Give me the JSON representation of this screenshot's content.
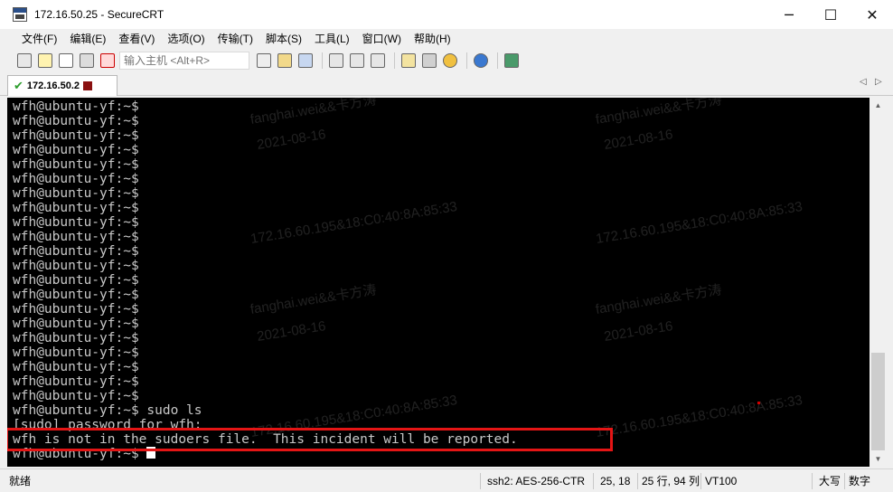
{
  "window": {
    "title": "172.16.50.25 - SecureCRT",
    "minimize": "─",
    "maximize": "☐",
    "close": "✕"
  },
  "menu": [
    "文件(F)",
    "编辑(E)",
    "查看(V)",
    "选项(O)",
    "传输(T)",
    "脚本(S)",
    "工具(L)",
    "窗口(W)",
    "帮助(H)"
  ],
  "toolbar": {
    "host_placeholder": "输入主机 <Alt+R>",
    "icons": [
      "connect-icon",
      "quick-connect-icon",
      "connect-tab-icon",
      "reconnect-icon",
      "disconnect-icon",
      "copy-icon",
      "paste-icon",
      "find-icon",
      "print-icon",
      "print-screen-icon",
      "print-setup-icon",
      "session-options-icon",
      "global-options-icon",
      "keymap-icon",
      "help-icon",
      "sftp-icon"
    ]
  },
  "tab": {
    "label": "172.16.50.2",
    "nav_left": "◁",
    "nav_right": "▷"
  },
  "terminal": {
    "lines": [
      "wfh@ubuntu-yf:~$",
      "wfh@ubuntu-yf:~$",
      "wfh@ubuntu-yf:~$",
      "wfh@ubuntu-yf:~$",
      "wfh@ubuntu-yf:~$",
      "wfh@ubuntu-yf:~$",
      "wfh@ubuntu-yf:~$",
      "wfh@ubuntu-yf:~$",
      "wfh@ubuntu-yf:~$",
      "wfh@ubuntu-yf:~$",
      "wfh@ubuntu-yf:~$",
      "wfh@ubuntu-yf:~$",
      "wfh@ubuntu-yf:~$",
      "wfh@ubuntu-yf:~$",
      "wfh@ubuntu-yf:~$",
      "wfh@ubuntu-yf:~$",
      "wfh@ubuntu-yf:~$",
      "wfh@ubuntu-yf:~$",
      "wfh@ubuntu-yf:~$",
      "wfh@ubuntu-yf:~$",
      "wfh@ubuntu-yf:~$",
      "wfh@ubuntu-yf:~$ sudo ls",
      "[sudo] password for wfh:",
      "wfh is not in the sudoers file.  This incident will be reported.",
      "wfh@ubuntu-yf:~$ "
    ],
    "watermarks": [
      "fanghai.wei&&卡方涛",
      "2021-08-16",
      "172.16.60.195&18:C0:40:8A:85:33"
    ]
  },
  "scrollbar": {
    "up": "▲",
    "down": "▼"
  },
  "status": {
    "ready": "就绪",
    "encryption": "ssh2: AES-256-CTR",
    "cursor_pos": "25,  18",
    "dimensions": "25 行, 94 列",
    "terminal_type": "VT100",
    "caps": "大写",
    "num": "数字"
  },
  "colors": {
    "terminal_bg": "#000000",
    "terminal_fg": "#c8c8c8",
    "highlight": "#e41515",
    "tab_check": "#2f9e2f"
  }
}
